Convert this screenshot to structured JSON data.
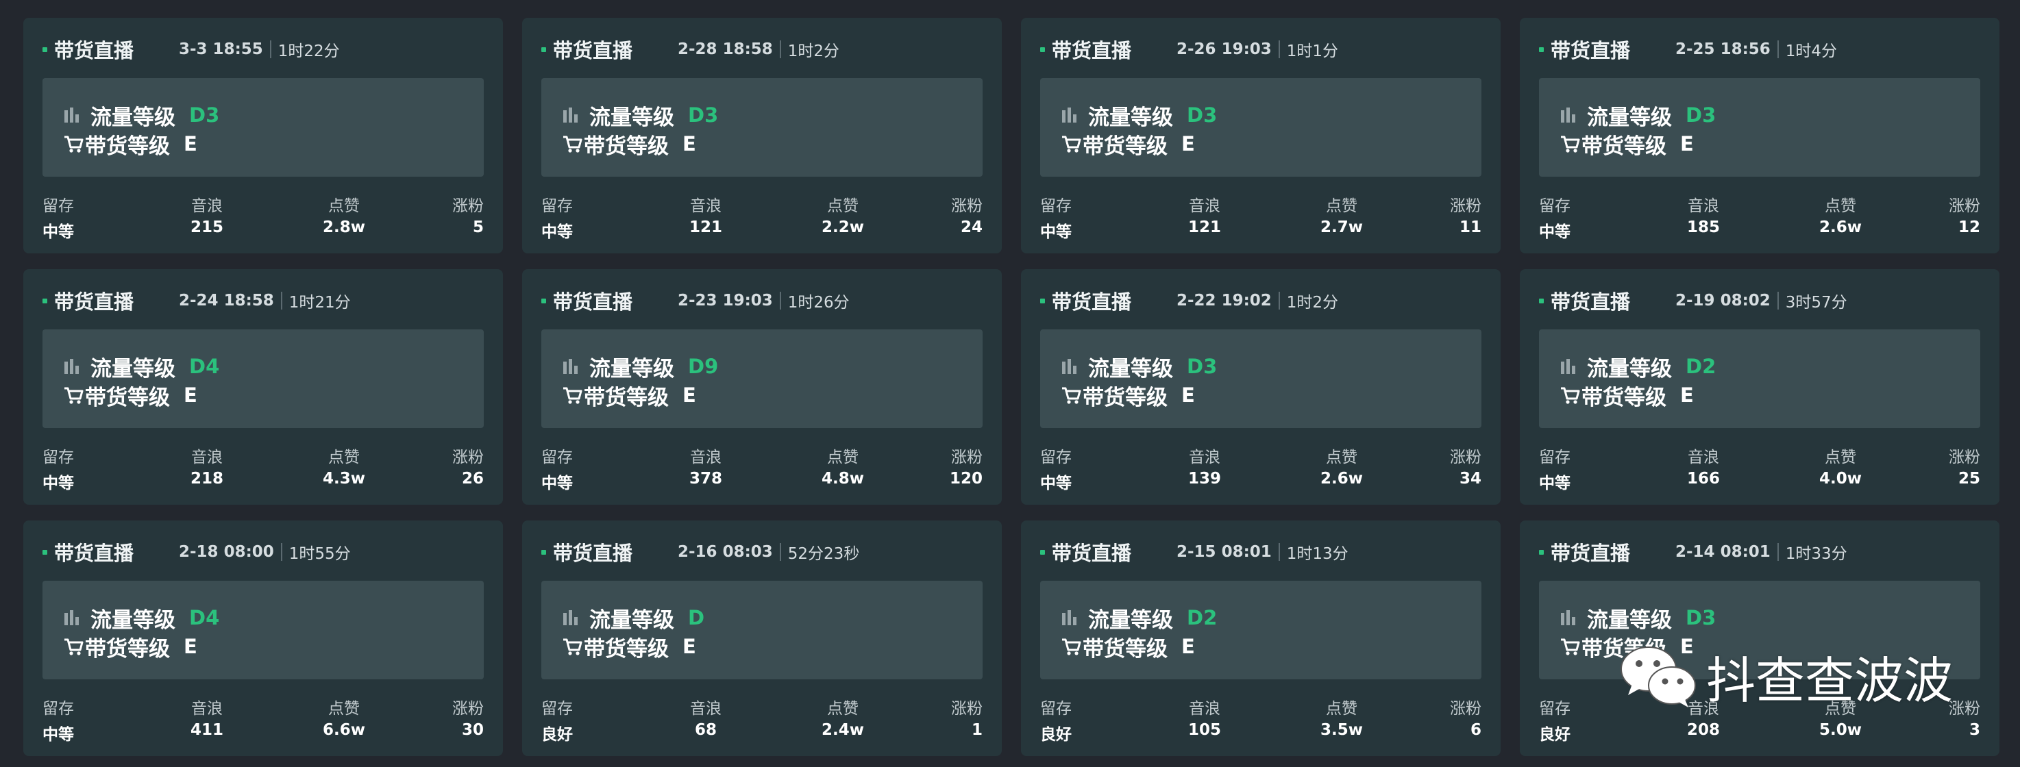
{
  "cards": [
    {
      "type": "带货直播",
      "time": "3-3 18:55",
      "duration": "1时22分",
      "flow_label": "流量等级",
      "flow_level": "D3",
      "goods_label": "带货等级",
      "goods_level": "E",
      "stats": [
        {
          "label": "留存",
          "value": "中等"
        },
        {
          "label": "音浪",
          "value": "215"
        },
        {
          "label": "点赞",
          "value": "2.8w"
        },
        {
          "label": "涨粉",
          "value": "5"
        }
      ]
    },
    {
      "type": "带货直播",
      "time": "2-28 18:58",
      "duration": "1时2分",
      "flow_label": "流量等级",
      "flow_level": "D3",
      "goods_label": "带货等级",
      "goods_level": "E",
      "stats": [
        {
          "label": "留存",
          "value": "中等"
        },
        {
          "label": "音浪",
          "value": "121"
        },
        {
          "label": "点赞",
          "value": "2.2w"
        },
        {
          "label": "涨粉",
          "value": "24"
        }
      ]
    },
    {
      "type": "带货直播",
      "time": "2-26 19:03",
      "duration": "1时1分",
      "flow_label": "流量等级",
      "flow_level": "D3",
      "goods_label": "带货等级",
      "goods_level": "E",
      "stats": [
        {
          "label": "留存",
          "value": "中等"
        },
        {
          "label": "音浪",
          "value": "121"
        },
        {
          "label": "点赞",
          "value": "2.7w"
        },
        {
          "label": "涨粉",
          "value": "11"
        }
      ]
    },
    {
      "type": "带货直播",
      "time": "2-25 18:56",
      "duration": "1时4分",
      "flow_label": "流量等级",
      "flow_level": "D3",
      "goods_label": "带货等级",
      "goods_level": "E",
      "stats": [
        {
          "label": "留存",
          "value": "中等"
        },
        {
          "label": "音浪",
          "value": "185"
        },
        {
          "label": "点赞",
          "value": "2.6w"
        },
        {
          "label": "涨粉",
          "value": "12"
        }
      ]
    },
    {
      "type": "带货直播",
      "time": "2-24 18:58",
      "duration": "1时21分",
      "flow_label": "流量等级",
      "flow_level": "D4",
      "goods_label": "带货等级",
      "goods_level": "E",
      "stats": [
        {
          "label": "留存",
          "value": "中等"
        },
        {
          "label": "音浪",
          "value": "218"
        },
        {
          "label": "点赞",
          "value": "4.3w"
        },
        {
          "label": "涨粉",
          "value": "26"
        }
      ]
    },
    {
      "type": "带货直播",
      "time": "2-23 19:03",
      "duration": "1时26分",
      "flow_label": "流量等级",
      "flow_level": "D9",
      "goods_label": "带货等级",
      "goods_level": "E",
      "stats": [
        {
          "label": "留存",
          "value": "中等"
        },
        {
          "label": "音浪",
          "value": "378"
        },
        {
          "label": "点赞",
          "value": "4.8w"
        },
        {
          "label": "涨粉",
          "value": "120"
        }
      ]
    },
    {
      "type": "带货直播",
      "time": "2-22 19:02",
      "duration": "1时2分",
      "flow_label": "流量等级",
      "flow_level": "D3",
      "goods_label": "带货等级",
      "goods_level": "E",
      "stats": [
        {
          "label": "留存",
          "value": "中等"
        },
        {
          "label": "音浪",
          "value": "139"
        },
        {
          "label": "点赞",
          "value": "2.6w"
        },
        {
          "label": "涨粉",
          "value": "34"
        }
      ]
    },
    {
      "type": "带货直播",
      "time": "2-19 08:02",
      "duration": "3时57分",
      "flow_label": "流量等级",
      "flow_level": "D2",
      "goods_label": "带货等级",
      "goods_level": "E",
      "stats": [
        {
          "label": "留存",
          "value": "中等"
        },
        {
          "label": "音浪",
          "value": "166"
        },
        {
          "label": "点赞",
          "value": "4.0w"
        },
        {
          "label": "涨粉",
          "value": "25"
        }
      ]
    },
    {
      "type": "带货直播",
      "time": "2-18 08:00",
      "duration": "1时55分",
      "flow_label": "流量等级",
      "flow_level": "D4",
      "goods_label": "带货等级",
      "goods_level": "E",
      "stats": [
        {
          "label": "留存",
          "value": "中等"
        },
        {
          "label": "音浪",
          "value": "411"
        },
        {
          "label": "点赞",
          "value": "6.6w"
        },
        {
          "label": "涨粉",
          "value": "30"
        }
      ]
    },
    {
      "type": "带货直播",
      "time": "2-16 08:03",
      "duration": "52分23秒",
      "flow_label": "流量等级",
      "flow_level": "D",
      "goods_label": "带货等级",
      "goods_level": "E",
      "stats": [
        {
          "label": "留存",
          "value": "良好"
        },
        {
          "label": "音浪",
          "value": "68"
        },
        {
          "label": "点赞",
          "value": "2.4w"
        },
        {
          "label": "涨粉",
          "value": "1"
        }
      ]
    },
    {
      "type": "带货直播",
      "time": "2-15 08:01",
      "duration": "1时13分",
      "flow_label": "流量等级",
      "flow_level": "D2",
      "goods_label": "带货等级",
      "goods_level": "E",
      "stats": [
        {
          "label": "留存",
          "value": "良好"
        },
        {
          "label": "音浪",
          "value": "105"
        },
        {
          "label": "点赞",
          "value": "3.5w"
        },
        {
          "label": "涨粉",
          "value": "6"
        }
      ]
    },
    {
      "type": "带货直播",
      "time": "2-14 08:01",
      "duration": "1时33分",
      "flow_label": "流量等级",
      "flow_level": "D3",
      "goods_label": "带货等级",
      "goods_level": "E",
      "stats": [
        {
          "label": "留存",
          "value": "良好"
        },
        {
          "label": "音浪",
          "value": "208"
        },
        {
          "label": "点赞",
          "value": "5.0w"
        },
        {
          "label": "涨粉",
          "value": "3"
        }
      ]
    }
  ],
  "watermark": {
    "text": "抖查查波波",
    "icon": "wechat-icon"
  },
  "colors": {
    "background": "#23272e",
    "card": "#26363b",
    "level_box": "#3b4d52",
    "accent_green": "#2bc17d"
  }
}
